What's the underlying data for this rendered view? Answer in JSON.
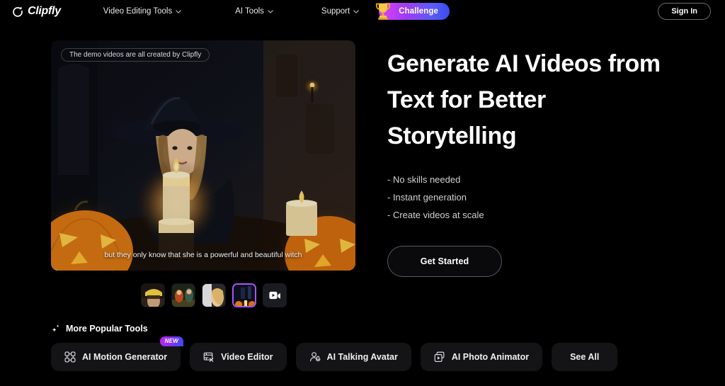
{
  "brand": {
    "name": "Clipfly",
    "logo_icon": "clipfly-camera-icon"
  },
  "nav": {
    "items": [
      {
        "label": "Video Editing Tools",
        "has_dropdown": true
      },
      {
        "label": "AI Tools",
        "has_dropdown": true
      },
      {
        "label": "Support",
        "has_dropdown": true
      }
    ],
    "challenge": {
      "label": "Challenge",
      "icon": "trophy-icon"
    },
    "signin_label": "Sign In"
  },
  "hero": {
    "video": {
      "badge": "The demo videos are all created by Clipfly",
      "subtitle": "but they only know that she is a powerful and beautiful witch",
      "scene": "halloween witch with candles and jack-o-lanterns"
    },
    "thumbnails": [
      {
        "name": "firefighter-clip",
        "selected": false
      },
      {
        "name": "couple-tavern-clip",
        "selected": false
      },
      {
        "name": "woman-window-clip",
        "selected": false
      },
      {
        "name": "halloween-witch-clip",
        "selected": true
      }
    ],
    "more_videos_icon": "video-camera-icon",
    "headline": "Generate AI Videos from Text for Better Storytelling",
    "bullets": [
      "- No skills needed",
      "- Instant generation",
      "- Create videos at scale"
    ],
    "cta_label": "Get Started"
  },
  "tools": {
    "title": "More Popular Tools",
    "title_icon": "sparkle-icon",
    "items": [
      {
        "label": "AI Motion Generator",
        "icon": "motion-nodes-icon",
        "badge": "NEW"
      },
      {
        "label": "Video Editor",
        "icon": "film-edit-icon",
        "badge": ""
      },
      {
        "label": "AI Talking Avatar",
        "icon": "avatar-mic-icon",
        "badge": ""
      },
      {
        "label": "AI Photo Animator",
        "icon": "photo-play-icon",
        "badge": ""
      },
      {
        "label": "See All",
        "icon": "",
        "badge": ""
      }
    ]
  },
  "colors": {
    "background": "#000000",
    "accent_purple": "#a855f7",
    "accent_blue": "#3b4cf0",
    "card": "#141417",
    "text_primary": "#ffffff",
    "text_secondary": "#d2d2d8"
  }
}
